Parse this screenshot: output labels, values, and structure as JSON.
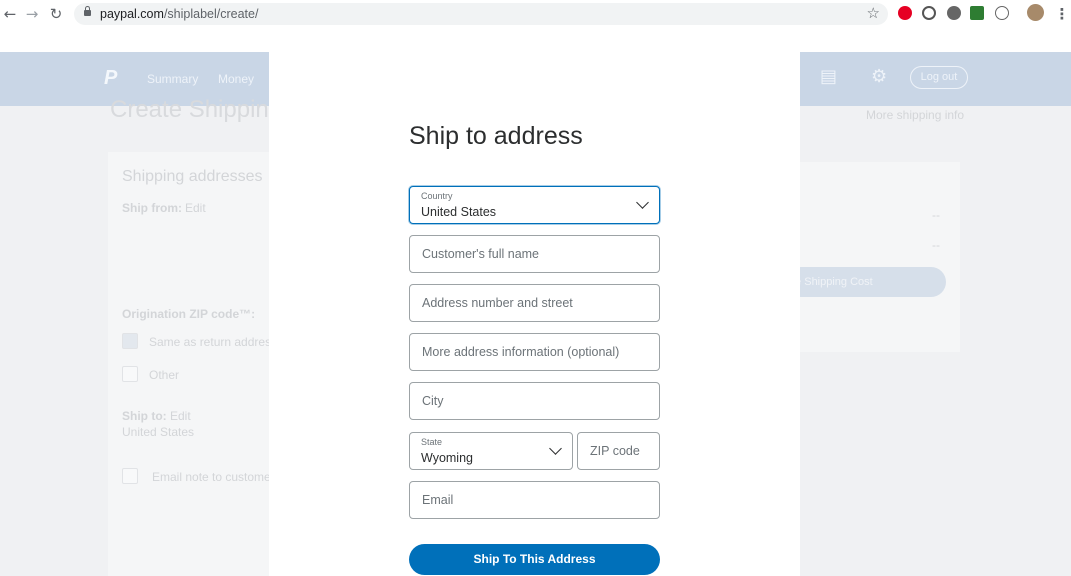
{
  "browser": {
    "url_domain": "paypal.com",
    "url_path": "/shiplabel/create/",
    "back_icon": "arrow-left-icon",
    "forward_icon": "arrow-right-icon",
    "reload_icon": "reload-icon",
    "bookmark_icon": "star-icon"
  },
  "background_page": {
    "nav": [
      "Summary",
      "Money"
    ],
    "logout_label": "Log out",
    "title": "Create Shipping",
    "more_info": "More shipping info",
    "shipping_addresses_heading": "Shipping addresses",
    "ship_from_label": "Ship from:",
    "ship_from_edit": "Edit",
    "origination_zip_label": "Origination ZIP code™:",
    "same_as_return": "Same as return address",
    "other": "Other",
    "ship_to_label": "Ship to:",
    "ship_to_edit": "Edit",
    "ship_to_value": "United States",
    "email_note": "Email note to customer",
    "dash1": "--",
    "dash2": "--",
    "cost_button": "te Shipping Cost"
  },
  "modal": {
    "title": "Ship to address",
    "country": {
      "label": "Country",
      "value": "United States"
    },
    "full_name_placeholder": "Customer's full name",
    "address1_placeholder": "Address number and street",
    "address2_placeholder": "More address information (optional)",
    "city_placeholder": "City",
    "state": {
      "label": "State",
      "value": "Wyoming"
    },
    "zip_placeholder": "ZIP code",
    "email_placeholder": "Email",
    "submit_label": "Ship To This Address"
  },
  "colors": {
    "accent": "#0070ba",
    "header_bg": "#c9d6e6"
  }
}
